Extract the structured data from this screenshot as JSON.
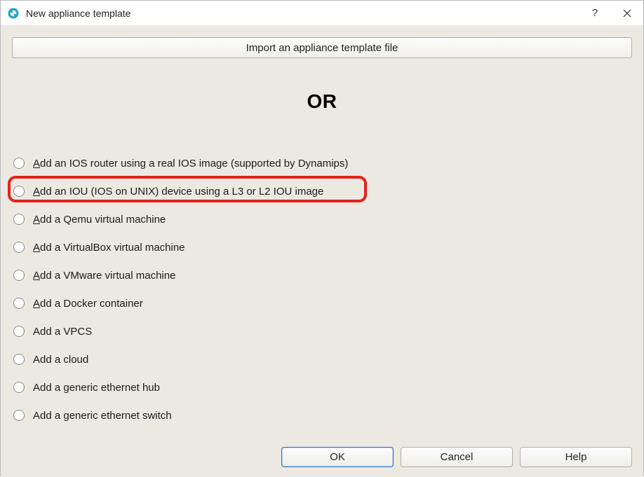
{
  "window": {
    "title": "New appliance template"
  },
  "import_button_label": "Import an appliance template file",
  "or_label": "OR",
  "options": [
    {
      "mnemonic": "A",
      "rest": "dd an IOS router using a real IOS image (supported by Dynamips)",
      "highlighted": false
    },
    {
      "mnemonic": "A",
      "rest": "dd an IOU (IOS on UNIX) device using a L3 or L2 IOU image",
      "highlighted": true
    },
    {
      "mnemonic": "A",
      "rest": "dd a Qemu virtual machine",
      "highlighted": false
    },
    {
      "mnemonic": "A",
      "rest": "dd a VirtualBox virtual machine",
      "highlighted": false
    },
    {
      "mnemonic": "A",
      "rest": "dd a VMware virtual machine",
      "highlighted": false
    },
    {
      "mnemonic": "A",
      "rest": "dd a Docker container",
      "highlighted": false
    },
    {
      "mnemonic": "",
      "rest": "Add a VPCS",
      "highlighted": false
    },
    {
      "mnemonic": "",
      "rest": "Add a cloud",
      "highlighted": false
    },
    {
      "mnemonic": "",
      "rest": "Add a generic ethernet hub",
      "highlighted": false
    },
    {
      "mnemonic": "",
      "rest": "Add a generic ethernet switch",
      "highlighted": false
    }
  ],
  "buttons": {
    "ok": "OK",
    "cancel": "Cancel",
    "help": "Help"
  },
  "titlebar_help_glyph": "?",
  "highlight_color": "#e2231a"
}
